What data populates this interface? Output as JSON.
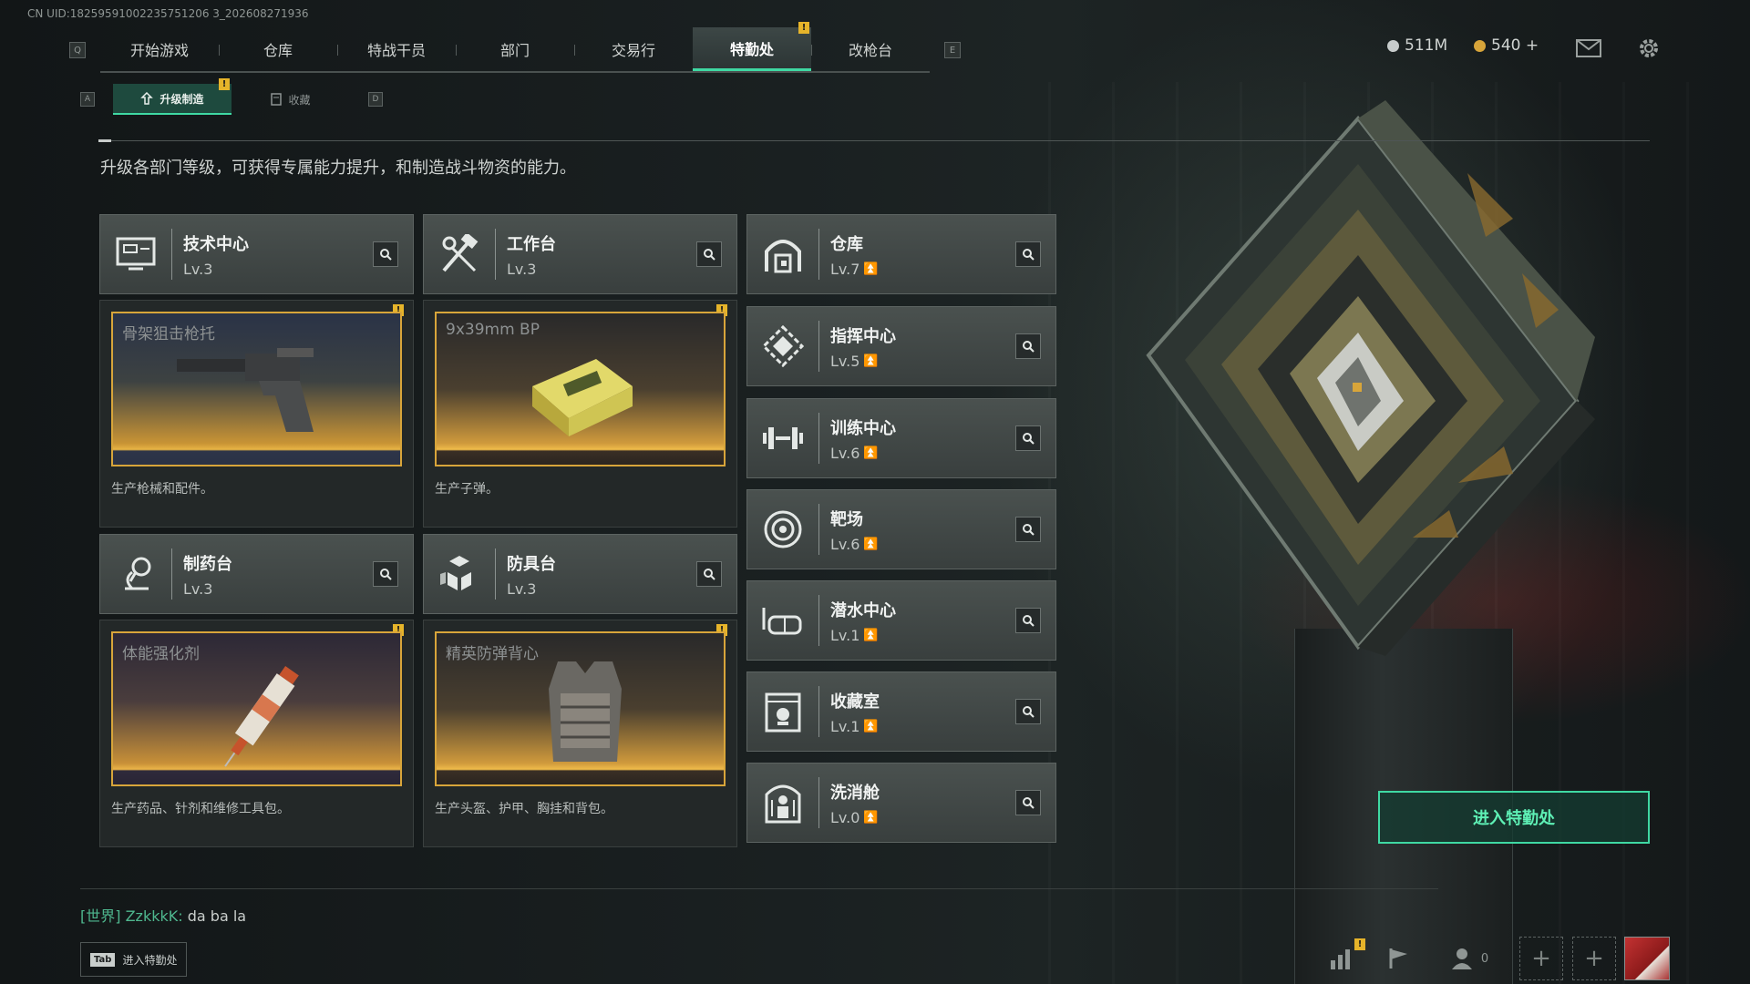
{
  "uid": "CN UID:18259591002235751206 3_202608271936",
  "nav": {
    "left_key": "Q",
    "right_key": "E",
    "tabs": [
      {
        "label": "开始游戏",
        "active": false
      },
      {
        "label": "仓库",
        "active": false
      },
      {
        "label": "特战干员",
        "active": false
      },
      {
        "label": "部门",
        "active": false
      },
      {
        "label": "交易行",
        "active": false
      },
      {
        "label": "特勤处",
        "active": true
      },
      {
        "label": "改枪台",
        "active": false
      }
    ],
    "alert_tab": "特勤处"
  },
  "currency": {
    "silver": "511M",
    "gold": "540 +",
    "silver_color": "#c7cccc",
    "gold_color": "#d8a53a"
  },
  "subnav": {
    "left_key": "A",
    "right_key": "D",
    "tabs": [
      {
        "label": "升级制造",
        "active": true,
        "icon": "upgrade-icon"
      },
      {
        "label": "收藏",
        "active": false,
        "icon": "collection-icon"
      }
    ]
  },
  "description": "升级各部门等级，可获得专属能力提升，和制造战斗物资的能力。",
  "facilities_main": [
    {
      "name": "技术中心",
      "level": "Lv.3",
      "icon": "tech-center-icon",
      "product": "骨架狙击枪托",
      "product_desc": "生产枪械和配件。"
    },
    {
      "name": "工作台",
      "level": "Lv.3",
      "icon": "workbench-icon",
      "product": "9x39mm BP",
      "product_desc": "生产子弹。"
    },
    {
      "name": "制药台",
      "level": "Lv.3",
      "icon": "pharmacy-icon",
      "product": "体能强化剂",
      "product_desc": "生产药品、针剂和维修工具包。"
    },
    {
      "name": "防具台",
      "level": "Lv.3",
      "icon": "armor-bench-icon",
      "product": "精英防弹背心",
      "product_desc": "生产头盔、护甲、胸挂和背包。"
    }
  ],
  "facilities_side": [
    {
      "name": "仓库",
      "level": "Lv.7",
      "icon": "warehouse-icon"
    },
    {
      "name": "指挥中心",
      "level": "Lv.5",
      "icon": "command-center-icon"
    },
    {
      "name": "训练中心",
      "level": "Lv.6",
      "icon": "training-center-icon"
    },
    {
      "name": "靶场",
      "level": "Lv.6",
      "icon": "shooting-range-icon"
    },
    {
      "name": "潜水中心",
      "level": "Lv.1",
      "icon": "diving-center-icon"
    },
    {
      "name": "收藏室",
      "level": "Lv.1",
      "icon": "collection-room-icon"
    },
    {
      "name": "洗消舱",
      "level": "Lv.0",
      "icon": "decon-chamber-icon"
    }
  ],
  "enter_button": "进入特勤处",
  "chat": {
    "channel": "[世界]",
    "user": "ZzkkkK:",
    "message": "da ba la"
  },
  "tab_hint": {
    "key": "Tab",
    "label": "进入特勤处"
  },
  "friends_count": "0",
  "colors": {
    "accent": "#3fd9a3",
    "alert": "#e6b42a",
    "upgrade_arrow": "#e6b42a"
  }
}
